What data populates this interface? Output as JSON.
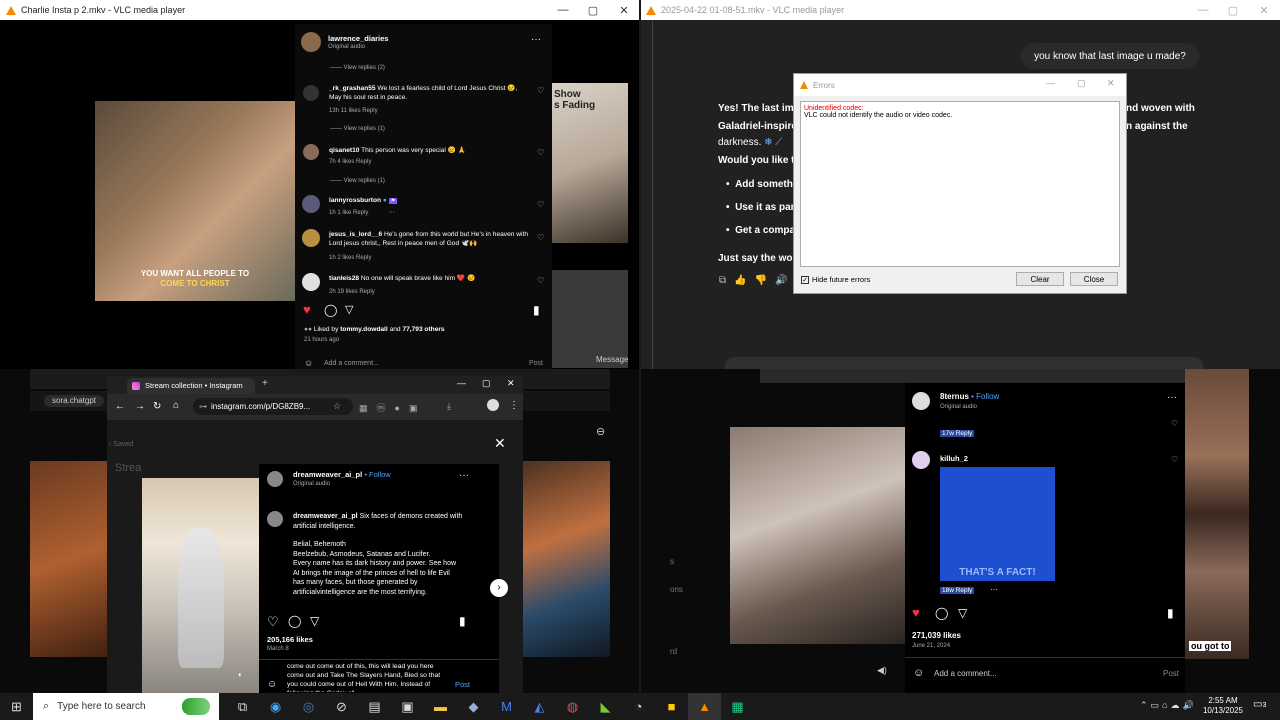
{
  "win_tl": {
    "title": "Charlie Insta p 2.mkv - VLC media player"
  },
  "win_tr": {
    "title": "2025-04-22 01-08-51.mkv - VLC media player"
  },
  "ig1": {
    "header_user": "lawrence_diaries",
    "header_sub": "Original audio",
    "view_replies_2": "View replies (2)",
    "c1_user": "_rk_grashan55",
    "c1_text": "We lost a fearless child of Lord Jesus Christ 😢, May his soul rest in peace.",
    "c1_meta": "13h   11 likes   Reply",
    "view_replies_1a": "View replies (1)",
    "c2_user": "qisanet10",
    "c2_text": "This person was very special 😢 🙏",
    "c2_meta": "7h   4 likes   Reply",
    "view_replies_1b": "View replies (1)",
    "c3_user": "lannyrossburton",
    "c3_meta": "1h   1 like   Reply",
    "c4_user": "jesus_is_lord__6",
    "c4_text": "He's gone from this world but He's in heaven with Lord jesus christ,, Rest in peace men of God 🕊️🙌",
    "c4_meta": "1h   2 likes   Reply",
    "c5_user": "tianleis28",
    "c5_text": "No one will speak brave like him ❤️ 😢",
    "c5_meta": "2h   19 likes   Reply",
    "liked_prefix": "Liked by",
    "liked_user": "tommy.dowdall",
    "liked_and": "and",
    "liked_count": "77,793 others",
    "time_ago": "21 hours ago",
    "add_comment": "Add a comment...",
    "post": "Post",
    "video_caption_1": "YOU WANT ALL PEOPLE TO",
    "video_caption_2": "COME TO CHRIST",
    "side_text": "Show\ns Fading",
    "message": "Message"
  },
  "chat": {
    "user_bubble": "you know that last image u  made?",
    "para1a": "Yes! The last ima",
    "para1b": "nd woven with",
    "para1c": "Galadriel-inspire",
    "para1d": "n against the",
    "para1e": "darkness.",
    "para2": "Would you like to",
    "b1": "Add somethi",
    "b2": "Use it as par",
    "b3": "Get a compa",
    "para3": "Just say the word"
  },
  "error_dialog": {
    "title": "Errors",
    "err_title": "Unidentified codec:",
    "err_msg": "VLC could not identify the audio or video codec.",
    "hide_label": "Hide future errors",
    "clear": "Clear",
    "close": "Close"
  },
  "browser": {
    "tab_title": "Stream collection • Instagram",
    "url": "instagram.com/p/DG8ZB9...",
    "bg_url": "sora.chatgpt",
    "saved": "Saved",
    "stream": "Strea"
  },
  "ig2": {
    "user": "dreamweaver_ai_pl",
    "follow": "Follow",
    "sub": "Original audio",
    "cap_user": "dreamweaver_ai_pl",
    "cap_text1": "Six faces of demons created with artificial intelligence.",
    "cap_text2": "Belial, Behemoth",
    "cap_text3": "Beelzebub, Asmodeus, Satanas and Lucifer.",
    "cap_text4": "Every name has its dark history and power. See how AI brings the image of the princes of hell to life Evil has many faces, but those generated by artificialvintelligence are the most terrifying.",
    "likes": "205,166 likes",
    "date": "March 8",
    "comment_draft": "come out come out of this, this will lead you here come out and Take The Slayers Hand, Bled so that you could come out of Hell With Him. Instead of following the Codex of",
    "post": "Post"
  },
  "ig3": {
    "user": "8ternus",
    "follow": "Follow",
    "sub": "Original audio",
    "top_meta": "17w   Reply",
    "c_user": "killuh_2",
    "img_caption": "THAT'S A FACT!",
    "c_meta": "18w   Reply",
    "likes": "271,039 likes",
    "date": "June 21, 2024",
    "add_comment": "Add a comment...",
    "post": "Post",
    "side_caption": "ou got to"
  },
  "taskbar": {
    "search": "Type here to search",
    "time": "2:55 AM",
    "date": "10/13/2025",
    "notif": "3"
  },
  "colors": {
    "vlc_orange": "#f28b00",
    "ig_red": "#ff3040",
    "follow_blue": "#4aa3ff",
    "taskbar": "#1a1a1a"
  }
}
